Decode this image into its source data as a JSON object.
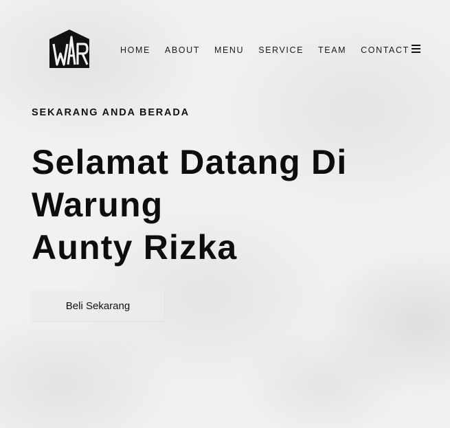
{
  "brand": {
    "logo_text": "WAR",
    "logo_icon": "war-monogram-logo"
  },
  "nav": {
    "items": [
      {
        "label": "HOME"
      },
      {
        "label": "ABOUT"
      },
      {
        "label": "MENU"
      },
      {
        "label": "SERVICE"
      },
      {
        "label": "TEAM"
      },
      {
        "label": "CONTACT"
      }
    ],
    "menu_icon": "hamburger-icon"
  },
  "hero": {
    "eyebrow": "SEKARANG ANDA BERADA",
    "title_lines": [
      "Selamat Datang Di",
      "Warung",
      "Aunty Rizka"
    ],
    "cta_label": "Beli Sekarang"
  }
}
